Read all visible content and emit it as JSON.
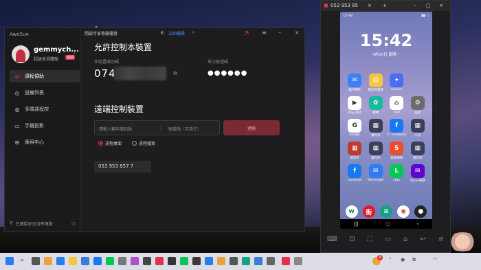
{
  "aw": {
    "app_title": "AweSun",
    "username": "gemmych...",
    "tier": "超級會員體驗",
    "tier_badge": "過期",
    "nav": [
      "遠程協助",
      "設備列表",
      "多端遠程控",
      "手機投影",
      "應用中心"
    ],
    "footer": "已連接安全加密鏈路",
    "promo": "開啟可享專屬優惠",
    "promo_link": "立即續費",
    "allow_title": "允許控制本裝置",
    "id_label": "本裝置識別碼",
    "id_value": "074",
    "pw_label": "單次驗證碼",
    "pw_value": "●●●●●●",
    "remote_title": "遠端控制裝置",
    "partner_placeholder": "請輸入夥伴識別碼",
    "pw_placeholder": "驗證碼（可為空）",
    "connect": "連線",
    "radio1": "遠程桌面",
    "radio2": "遠程檔案",
    "history": "053 953 857 7"
  },
  "mirror": {
    "title": "053 953 85",
    "status_time": "15:42",
    "clock": "15:42",
    "date": "4月20日 星期一",
    "apps": [
      {
        "name": "電子郵件",
        "color": "#3b82f6",
        "glyph": "✉"
      },
      {
        "name": "檔案管理員",
        "color": "#f5c542",
        "glyph": "▤"
      },
      {
        "name": "Gemini",
        "color": "#4a6cf7",
        "glyph": "✦"
      },
      {
        "name": "",
        "color": "transparent",
        "glyph": ""
      },
      {
        "name": "Play 商店",
        "color": "#ffffff",
        "glyph": "▶"
      },
      {
        "name": "相簿",
        "color": "#1bb7a0",
        "glyph": "✿"
      },
      {
        "name": "Tapo",
        "color": "#ffffff",
        "glyph": "⌂"
      },
      {
        "name": "設定",
        "color": "#6c6c70",
        "glyph": "⚙"
      },
      {
        "name": "Google",
        "color": "#ffffff",
        "glyph": "G"
      },
      {
        "name": "資料夾",
        "color": "#3a3f5c",
        "glyph": "▦"
      },
      {
        "name": "II - Facebook",
        "color": "#1877f2",
        "glyph": "f"
      },
      {
        "name": "工具",
        "color": "#3a3f5c",
        "glyph": "▦"
      },
      {
        "name": "資料夾",
        "color": "#c0392b",
        "glyph": "▦"
      },
      {
        "name": "資料夾",
        "color": "#3a3f5c",
        "glyph": "▦"
      },
      {
        "name": "蝦皮購物",
        "color": "#ee4d2d",
        "glyph": "S"
      },
      {
        "name": "資料夾",
        "color": "#3a3f5c",
        "glyph": "▦"
      },
      {
        "name": "Facebook",
        "color": "#1877f2",
        "glyph": "f"
      },
      {
        "name": "Messenger",
        "color": "#2f7bf6",
        "glyph": "✉"
      },
      {
        "name": "LINE",
        "color": "#06c755",
        "glyph": "L"
      },
      {
        "name": "Yahoo奇摩",
        "color": "#6001d2",
        "glyph": "✉"
      }
    ],
    "dock": [
      {
        "color": "#ffffff",
        "glyph": "w",
        "fg": "#1a8a4c"
      },
      {
        "color": "#e01b24",
        "glyph": "街",
        "fg": "#fff"
      },
      {
        "color": "#16a085",
        "glyph": "≡",
        "fg": "#fff"
      },
      {
        "color": "#ffffff",
        "glyph": "◉",
        "fg": "#db4437"
      },
      {
        "color": "#222",
        "glyph": "●",
        "fg": "#fff"
      }
    ]
  },
  "taskbar": {
    "notif_count": "4"
  }
}
